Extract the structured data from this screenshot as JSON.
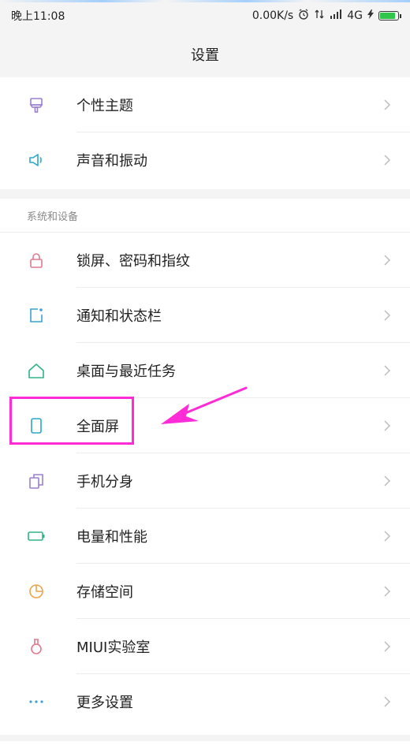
{
  "status_bar": {
    "time": "晚上11:08",
    "speed": "0.00K/s",
    "network": "4G"
  },
  "header": {
    "title": "设置"
  },
  "groups": [
    {
      "items": [
        {
          "label": "个性主题",
          "icon": "theme-brush-icon",
          "color": "#9b7fd0"
        },
        {
          "label": "声音和振动",
          "icon": "speaker-icon",
          "color": "#2aa7c9"
        }
      ]
    },
    {
      "header": "系统和设备",
      "items": [
        {
          "label": "锁屏、密码和指纹",
          "icon": "lock-icon",
          "color": "#e07a8e"
        },
        {
          "label": "通知和状态栏",
          "icon": "notification-icon",
          "color": "#3aa0d8"
        },
        {
          "label": "桌面与最近任务",
          "icon": "home-icon",
          "color": "#2fb38a"
        },
        {
          "label": "全面屏",
          "icon": "phone-icon",
          "color": "#2aa7c9"
        },
        {
          "label": "手机分身",
          "icon": "dual-app-icon",
          "color": "#9b7fd0"
        },
        {
          "label": "电量和性能",
          "icon": "battery-icon",
          "color": "#2fb38a"
        },
        {
          "label": "存储空间",
          "icon": "storage-pie-icon",
          "color": "#f0a24a"
        },
        {
          "label": "MIUI实验室",
          "icon": "lab-flask-icon",
          "color": "#e07a8e"
        },
        {
          "label": "更多设置",
          "icon": "more-dots-icon",
          "color": "#3aa0d8"
        }
      ]
    }
  ],
  "colors": {
    "annotation": "#ff2bd6",
    "battery_fill": "#30c64a"
  }
}
